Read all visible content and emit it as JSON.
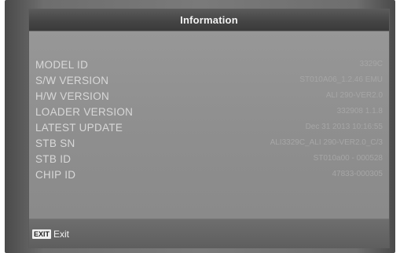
{
  "window": {
    "title": "Information"
  },
  "info_rows": [
    {
      "label": "MODEL ID",
      "value": "3329C"
    },
    {
      "label": "S/W VERSION",
      "value": "ST010A06_1.2.46 EMU"
    },
    {
      "label": "H/W VERSION",
      "value": "ALI 290-VER2.0"
    },
    {
      "label": "LOADER VERSION",
      "value": "332908 1.1.8"
    },
    {
      "label": "LATEST UPDATE",
      "value": "Dec 31 2013 10:16:55"
    },
    {
      "label": "STB SN",
      "value": "ALI3329C_ALI 290-VER2.0_C/3"
    },
    {
      "label": "STB ID",
      "value": "ST010a00 - 000528"
    },
    {
      "label": "CHIP ID",
      "value": "47833-000305"
    }
  ],
  "footer": {
    "exit_key": "EXIT",
    "exit_label": "Exit"
  }
}
